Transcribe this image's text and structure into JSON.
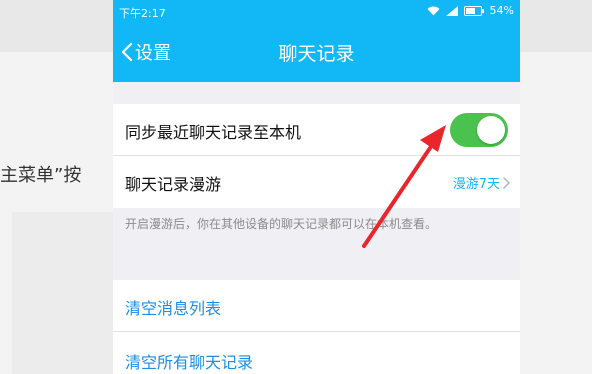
{
  "background": {
    "article_text": "主菜单”按"
  },
  "statusbar": {
    "time": "下午2:17",
    "battery": "54%"
  },
  "navbar": {
    "back_label": "设置",
    "title": "聊天记录"
  },
  "settings": {
    "sync_label": "同步最近聊天记录至本机",
    "sync_enabled": true,
    "roam_label": "聊天记录漫游",
    "roam_value": "漫游7天",
    "hint": "开启漫游后，你在其他设备的聊天记录都可以在本机查看。",
    "clear_message_list": "清空消息列表",
    "clear_all_chats": "清空所有聊天记录"
  },
  "colors": {
    "accent": "#12b7f5",
    "toggle_on": "#4cc24e",
    "link_blue": "#1a8ee8",
    "arrow": "#e8262b"
  }
}
